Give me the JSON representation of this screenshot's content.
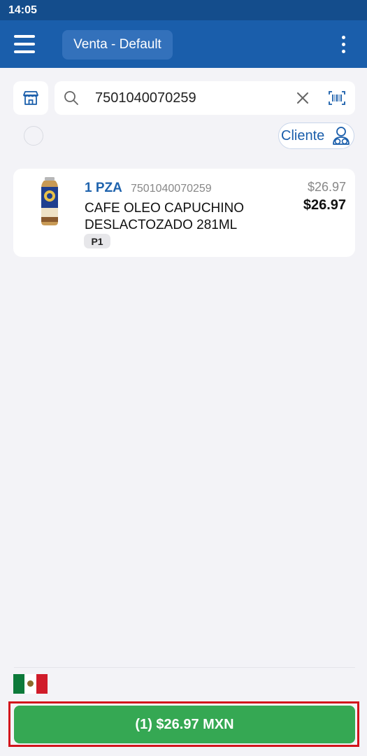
{
  "status_bar": {
    "time": "14:05"
  },
  "app_bar": {
    "title": "Venta - Default",
    "menu_icon": "hamburger-menu-icon",
    "more_icon": "more-vert-icon"
  },
  "search": {
    "value": "7501040070259",
    "placeholder": "",
    "store_icon": "store-icon",
    "search_icon": "search-icon",
    "clear_icon": "close-icon",
    "scan_icon": "barcode-scan-icon"
  },
  "customer": {
    "label": "Cliente",
    "icon": "customer-icon"
  },
  "cart": {
    "items": [
      {
        "quantity": "1 PZA",
        "sku": "7501040070259",
        "name": "CAFE OLEO CAPUCHINO DESLACTOZADO 281ML",
        "price_level": "P1",
        "original_price": "$26.97",
        "price": "$26.97"
      }
    ]
  },
  "footer": {
    "currency_flag": "mexico-flag-icon",
    "checkout_label": "(1) $26.97 MXN"
  },
  "colors": {
    "status_bar": "#144d8c",
    "app_bar": "#1a5eab",
    "accent_blue": "#1f63ad",
    "checkout_green": "#35a853",
    "highlight_red": "#d2141c",
    "background": "#f3f3f7"
  }
}
